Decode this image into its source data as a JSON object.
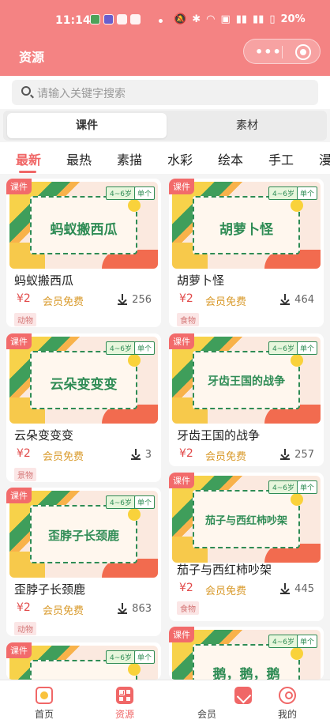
{
  "status_bar": {
    "time": "11:14",
    "battery": "20%"
  },
  "header": {
    "title": "资源",
    "more_label": "•••"
  },
  "search": {
    "placeholder": "请输入关键字搜索"
  },
  "segment": {
    "options": [
      "课件",
      "素材"
    ],
    "selected": "课件"
  },
  "categories": [
    "最新",
    "最热",
    "素描",
    "水彩",
    "绘本",
    "手工",
    "漫"
  ],
  "selected_category": "最新",
  "cards": [
    {
      "ribbon": "课件",
      "age": "4~6岁",
      "single": "单个",
      "thumb_title": "蚂蚁搬西瓜",
      "title": "蚂蚁搬西瓜",
      "price": "¥2",
      "vip": "会员免费",
      "downloads": "256",
      "tag": "动物"
    },
    {
      "ribbon": "课件",
      "age": "4~6岁",
      "single": "单个",
      "thumb_title": "胡萝卜怪",
      "title": "胡萝卜怪",
      "price": "¥2",
      "vip": "会员免费",
      "downloads": "464",
      "tag": "食物"
    },
    {
      "ribbon": "课件",
      "age": "4~6岁",
      "single": "单个",
      "thumb_title": "云朵变变变",
      "title": "云朵变变变",
      "price": "¥2",
      "vip": "会员免费",
      "downloads": "3",
      "tag": "景物"
    },
    {
      "ribbon": "课件",
      "age": "4~6岁",
      "single": "单个",
      "thumb_title": "牙齿王国的战争",
      "title": "牙齿王国的战争",
      "price": "¥2",
      "vip": "会员免费",
      "downloads": "257",
      "tag": ""
    },
    {
      "ribbon": "课件",
      "age": "4~6岁",
      "single": "单个",
      "thumb_title": "歪脖子长颈鹿",
      "title": "歪脖子长颈鹿",
      "price": "¥2",
      "vip": "会员免费",
      "downloads": "863",
      "tag": "动物"
    },
    {
      "ribbon": "课件",
      "age": "4~6岁",
      "single": "单个",
      "thumb_title": "茄子与西红柿吵架",
      "title": "茄子与西红柿吵架",
      "price": "¥2",
      "vip": "会员免费",
      "downloads": "445",
      "tag": "食物"
    },
    {
      "ribbon": "课件",
      "age": "4~6岁",
      "single": "单个",
      "thumb_title": "",
      "title": "",
      "price": "",
      "vip": "",
      "downloads": "",
      "tag": ""
    },
    {
      "ribbon": "课件",
      "age": "4~6岁",
      "single": "单个",
      "thumb_title": "鹅，鹅，鹅",
      "title": "",
      "price": "",
      "vip": "",
      "downloads": "",
      "tag": ""
    }
  ],
  "bottom_nav": {
    "items": [
      "首页",
      "资源",
      "会员",
      "我的"
    ],
    "selected": "资源"
  },
  "colors": {
    "brand": "#f48383",
    "accent": "#f06767",
    "price": "#e24b4b",
    "vip": "#d99a2b",
    "thumb_green": "#2f8c55"
  }
}
